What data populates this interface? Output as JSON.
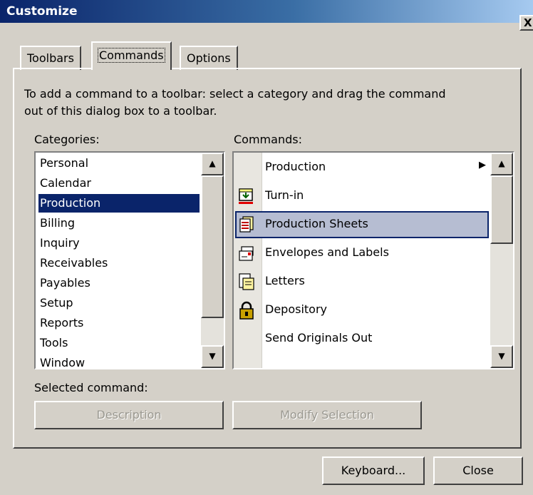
{
  "window": {
    "title": "Customize",
    "close_label": "X"
  },
  "tabs": [
    {
      "label": "Toolbars",
      "active": false
    },
    {
      "label": "Commands",
      "active": true
    },
    {
      "label": "Options",
      "active": false
    }
  ],
  "instructions": {
    "line1": "To add a command to a toolbar: select a category and drag the command",
    "line2": "out of this dialog box to a toolbar."
  },
  "categories": {
    "label": "Categories:",
    "selected": "Production",
    "items": [
      "Personal",
      "Calendar",
      "Production",
      "Billing",
      "Inquiry",
      "Receivables",
      "Payables",
      "Setup",
      "Reports",
      "Tools",
      "Window"
    ]
  },
  "commands": {
    "label": "Commands:",
    "selected": "Production Sheets",
    "items": [
      {
        "label": "Production",
        "icon": "none",
        "submenu": true
      },
      {
        "label": "Turn-in",
        "icon": "turn-in-icon"
      },
      {
        "label": "Production Sheets",
        "icon": "production-sheets-icon"
      },
      {
        "label": "Envelopes and Labels",
        "icon": "envelopes-icon"
      },
      {
        "label": "Letters",
        "icon": "letters-icon"
      },
      {
        "label": "Depository",
        "icon": "lock-icon"
      },
      {
        "label": "Send Originals Out",
        "icon": "none"
      }
    ]
  },
  "selected_command": {
    "label": "Selected command:",
    "description_button": "Description",
    "modify_button": "Modify Selection"
  },
  "footer": {
    "keyboard_button": "Keyboard...",
    "close_button": "Close"
  },
  "colors": {
    "selection": "#0a246a",
    "hover_highlight": "#b6bdd2",
    "face": "#d4d0c8"
  }
}
